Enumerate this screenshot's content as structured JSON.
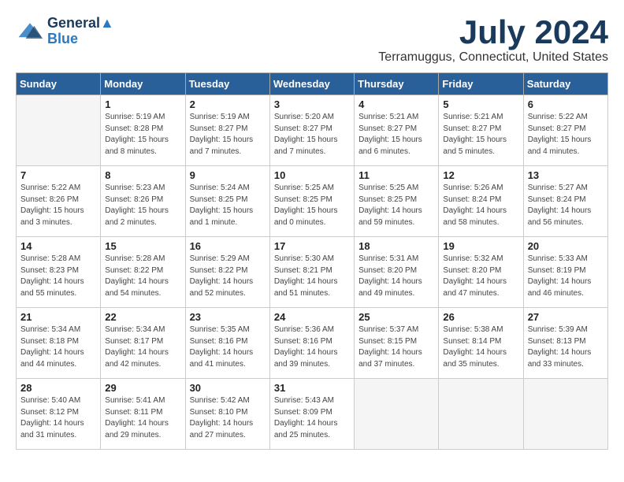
{
  "header": {
    "logo_line1": "General",
    "logo_line2": "Blue",
    "month": "July 2024",
    "location": "Terramuggus, Connecticut, United States"
  },
  "weekdays": [
    "Sunday",
    "Monday",
    "Tuesday",
    "Wednesday",
    "Thursday",
    "Friday",
    "Saturday"
  ],
  "weeks": [
    [
      {
        "day": "",
        "info": ""
      },
      {
        "day": "1",
        "info": "Sunrise: 5:19 AM\nSunset: 8:28 PM\nDaylight: 15 hours\nand 8 minutes."
      },
      {
        "day": "2",
        "info": "Sunrise: 5:19 AM\nSunset: 8:27 PM\nDaylight: 15 hours\nand 7 minutes."
      },
      {
        "day": "3",
        "info": "Sunrise: 5:20 AM\nSunset: 8:27 PM\nDaylight: 15 hours\nand 7 minutes."
      },
      {
        "day": "4",
        "info": "Sunrise: 5:21 AM\nSunset: 8:27 PM\nDaylight: 15 hours\nand 6 minutes."
      },
      {
        "day": "5",
        "info": "Sunrise: 5:21 AM\nSunset: 8:27 PM\nDaylight: 15 hours\nand 5 minutes."
      },
      {
        "day": "6",
        "info": "Sunrise: 5:22 AM\nSunset: 8:27 PM\nDaylight: 15 hours\nand 4 minutes."
      }
    ],
    [
      {
        "day": "7",
        "info": "Sunrise: 5:22 AM\nSunset: 8:26 PM\nDaylight: 15 hours\nand 3 minutes."
      },
      {
        "day": "8",
        "info": "Sunrise: 5:23 AM\nSunset: 8:26 PM\nDaylight: 15 hours\nand 2 minutes."
      },
      {
        "day": "9",
        "info": "Sunrise: 5:24 AM\nSunset: 8:25 PM\nDaylight: 15 hours\nand 1 minute."
      },
      {
        "day": "10",
        "info": "Sunrise: 5:25 AM\nSunset: 8:25 PM\nDaylight: 15 hours\nand 0 minutes."
      },
      {
        "day": "11",
        "info": "Sunrise: 5:25 AM\nSunset: 8:25 PM\nDaylight: 14 hours\nand 59 minutes."
      },
      {
        "day": "12",
        "info": "Sunrise: 5:26 AM\nSunset: 8:24 PM\nDaylight: 14 hours\nand 58 minutes."
      },
      {
        "day": "13",
        "info": "Sunrise: 5:27 AM\nSunset: 8:24 PM\nDaylight: 14 hours\nand 56 minutes."
      }
    ],
    [
      {
        "day": "14",
        "info": "Sunrise: 5:28 AM\nSunset: 8:23 PM\nDaylight: 14 hours\nand 55 minutes."
      },
      {
        "day": "15",
        "info": "Sunrise: 5:28 AM\nSunset: 8:22 PM\nDaylight: 14 hours\nand 54 minutes."
      },
      {
        "day": "16",
        "info": "Sunrise: 5:29 AM\nSunset: 8:22 PM\nDaylight: 14 hours\nand 52 minutes."
      },
      {
        "day": "17",
        "info": "Sunrise: 5:30 AM\nSunset: 8:21 PM\nDaylight: 14 hours\nand 51 minutes."
      },
      {
        "day": "18",
        "info": "Sunrise: 5:31 AM\nSunset: 8:20 PM\nDaylight: 14 hours\nand 49 minutes."
      },
      {
        "day": "19",
        "info": "Sunrise: 5:32 AM\nSunset: 8:20 PM\nDaylight: 14 hours\nand 47 minutes."
      },
      {
        "day": "20",
        "info": "Sunrise: 5:33 AM\nSunset: 8:19 PM\nDaylight: 14 hours\nand 46 minutes."
      }
    ],
    [
      {
        "day": "21",
        "info": "Sunrise: 5:34 AM\nSunset: 8:18 PM\nDaylight: 14 hours\nand 44 minutes."
      },
      {
        "day": "22",
        "info": "Sunrise: 5:34 AM\nSunset: 8:17 PM\nDaylight: 14 hours\nand 42 minutes."
      },
      {
        "day": "23",
        "info": "Sunrise: 5:35 AM\nSunset: 8:16 PM\nDaylight: 14 hours\nand 41 minutes."
      },
      {
        "day": "24",
        "info": "Sunrise: 5:36 AM\nSunset: 8:16 PM\nDaylight: 14 hours\nand 39 minutes."
      },
      {
        "day": "25",
        "info": "Sunrise: 5:37 AM\nSunset: 8:15 PM\nDaylight: 14 hours\nand 37 minutes."
      },
      {
        "day": "26",
        "info": "Sunrise: 5:38 AM\nSunset: 8:14 PM\nDaylight: 14 hours\nand 35 minutes."
      },
      {
        "day": "27",
        "info": "Sunrise: 5:39 AM\nSunset: 8:13 PM\nDaylight: 14 hours\nand 33 minutes."
      }
    ],
    [
      {
        "day": "28",
        "info": "Sunrise: 5:40 AM\nSunset: 8:12 PM\nDaylight: 14 hours\nand 31 minutes."
      },
      {
        "day": "29",
        "info": "Sunrise: 5:41 AM\nSunset: 8:11 PM\nDaylight: 14 hours\nand 29 minutes."
      },
      {
        "day": "30",
        "info": "Sunrise: 5:42 AM\nSunset: 8:10 PM\nDaylight: 14 hours\nand 27 minutes."
      },
      {
        "day": "31",
        "info": "Sunrise: 5:43 AM\nSunset: 8:09 PM\nDaylight: 14 hours\nand 25 minutes."
      },
      {
        "day": "",
        "info": ""
      },
      {
        "day": "",
        "info": ""
      },
      {
        "day": "",
        "info": ""
      }
    ]
  ]
}
